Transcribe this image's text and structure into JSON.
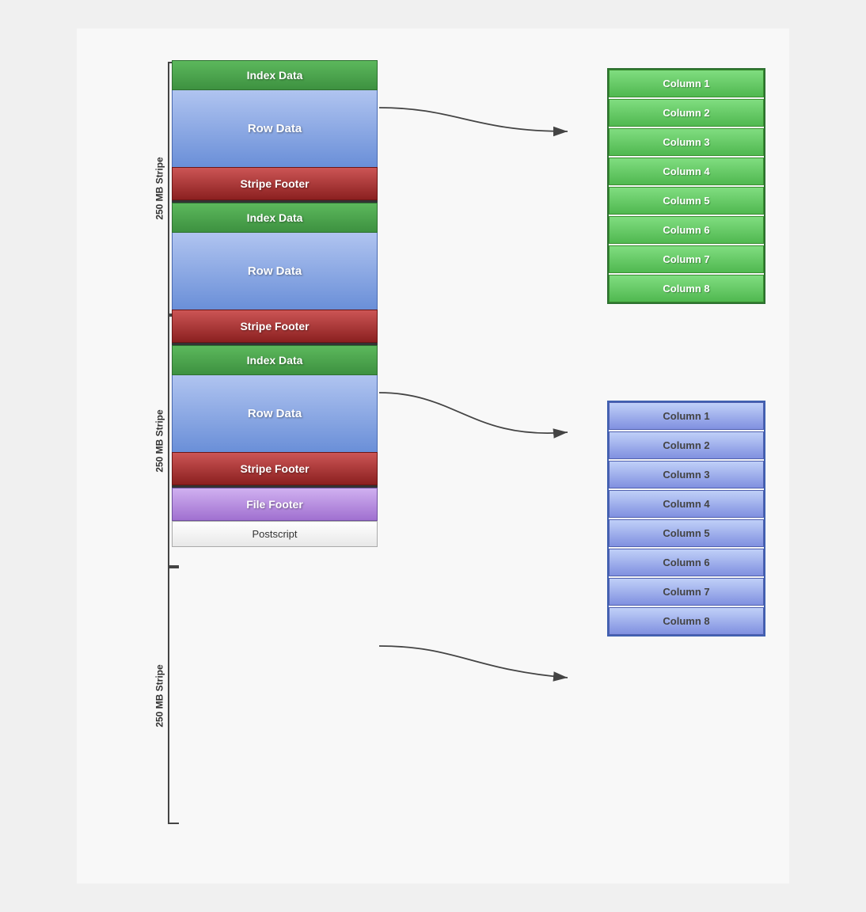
{
  "stripes": [
    {
      "id": "stripe1",
      "label": "250 MB Stripe",
      "index_label": "Index Data",
      "row_label": "Row Data",
      "footer_label": "Stripe Footer"
    },
    {
      "id": "stripe2",
      "label": "250 MB Stripe",
      "index_label": "Index Data",
      "row_label": "Row Data",
      "footer_label": "Stripe Footer"
    },
    {
      "id": "stripe3",
      "label": "250 MB Stripe",
      "index_label": "Index Data",
      "row_label": "Row Data",
      "footer_label": "Stripe Footer"
    }
  ],
  "file_footer_label": "File Footer",
  "postscript_label": "Postscript",
  "green_columns": [
    "Column 1",
    "Column 2",
    "Column 3",
    "Column 4",
    "Column 5",
    "Column 6",
    "Column 7",
    "Column 8"
  ],
  "blue_columns": [
    "Column 1",
    "Column 2",
    "Column 3",
    "Column 4",
    "Column 5",
    "Column 6",
    "Column 7",
    "Column 8"
  ]
}
